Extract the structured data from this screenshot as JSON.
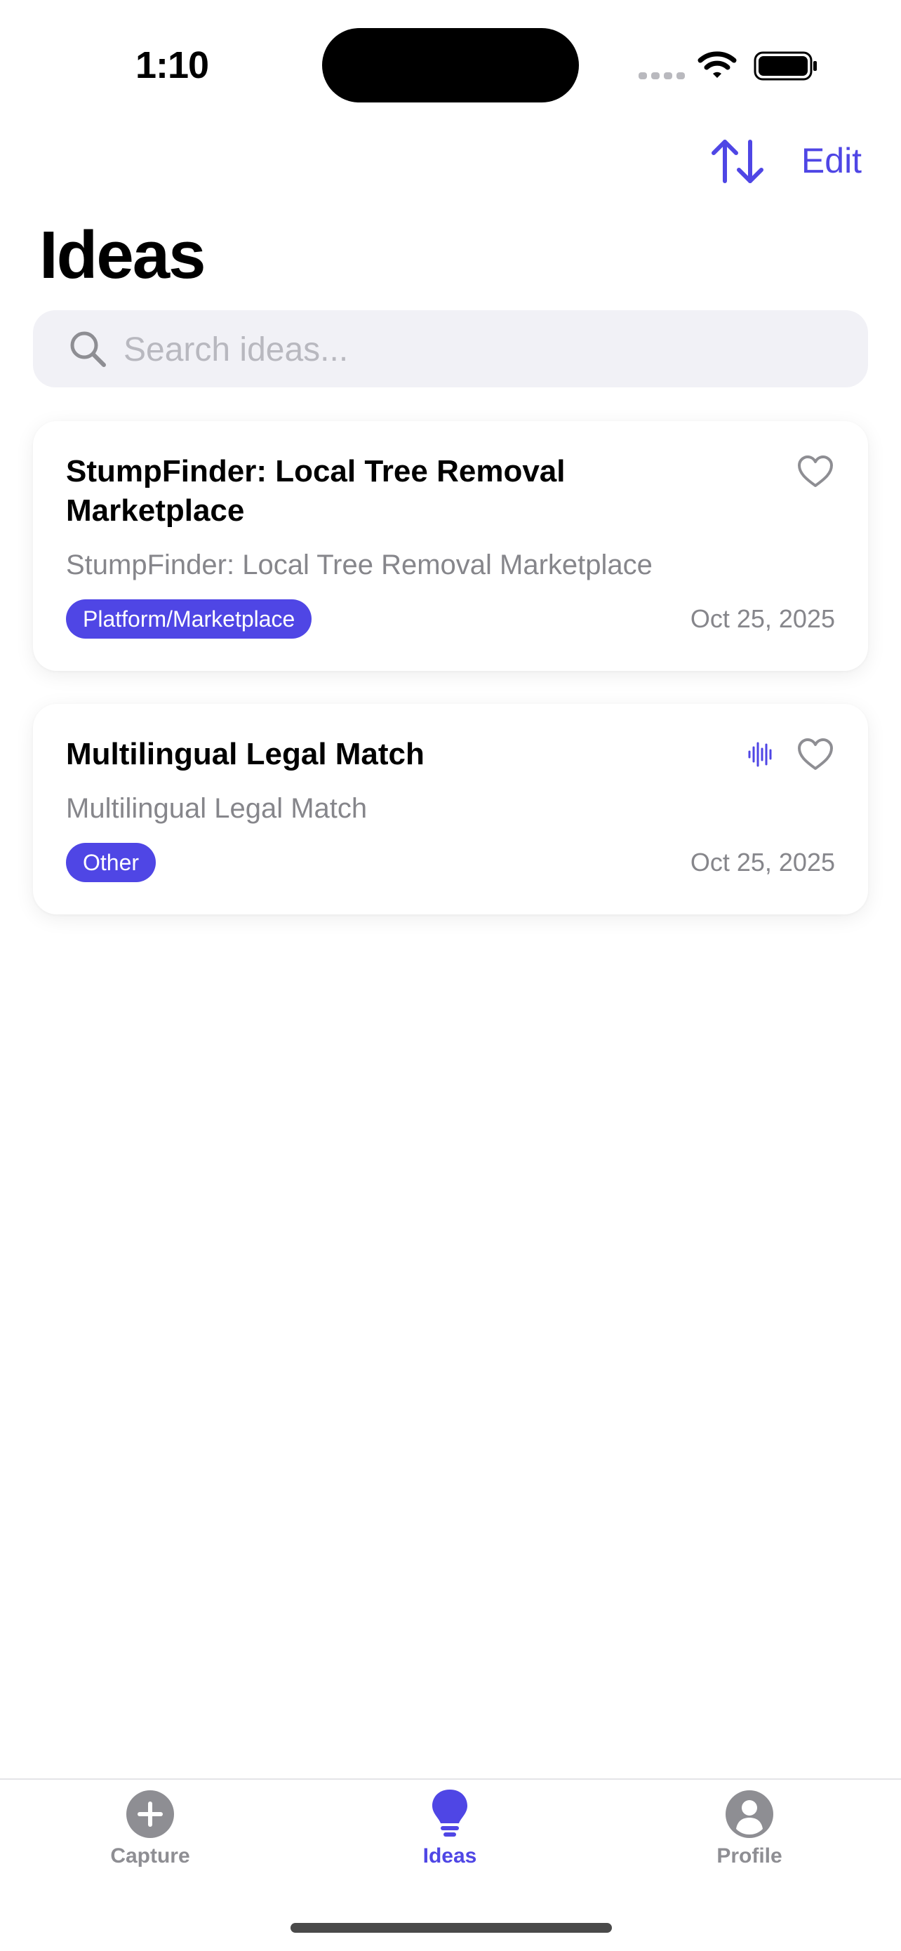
{
  "status_bar": {
    "time": "1:10"
  },
  "nav": {
    "sort_icon": "sort-arrows-icon",
    "edit_label": "Edit",
    "title": "Ideas"
  },
  "search": {
    "placeholder": "Search ideas...",
    "value": ""
  },
  "ideas": [
    {
      "title": "StumpFinder: Local Tree Removal Marketplace",
      "subtitle": "StumpFinder: Local Tree Removal Marketplace",
      "tag": "Platform/Marketplace",
      "date": "Oct 25, 2025",
      "has_audio": false,
      "favorite": false
    },
    {
      "title": "Multilingual Legal Match",
      "subtitle": "Multilingual Legal Match",
      "tag": "Other",
      "date": "Oct 25, 2025",
      "has_audio": true,
      "favorite": false
    }
  ],
  "tab_bar": {
    "items": [
      {
        "label": "Capture",
        "icon": "plus-circle-icon",
        "active": false
      },
      {
        "label": "Ideas",
        "icon": "lightbulb-icon",
        "active": true
      },
      {
        "label": "Profile",
        "icon": "person-circle-icon",
        "active": false
      }
    ]
  },
  "colors": {
    "accent": "#4f46e5",
    "inactive": "#8e8e93",
    "secondary_text": "#86868b",
    "search_bg": "#f1f1f6"
  }
}
